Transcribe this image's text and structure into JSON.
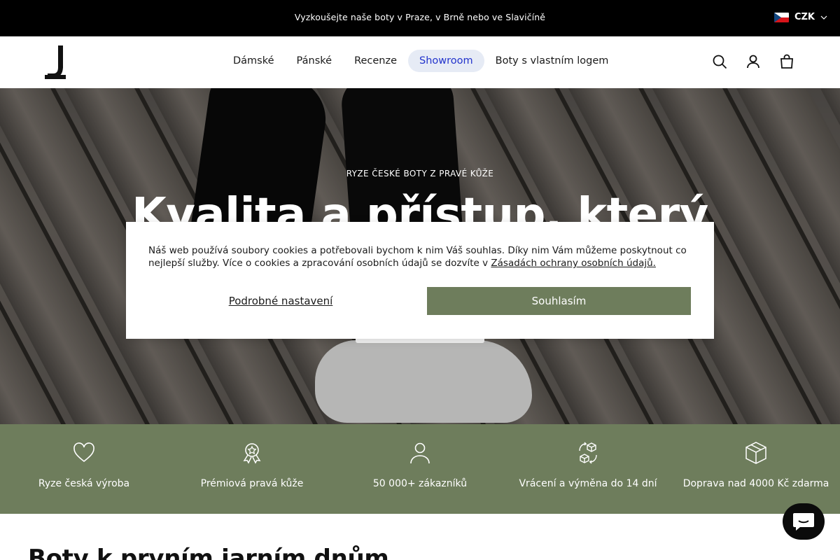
{
  "announcement": {
    "text": "Vyzkoušejte naše boty v Praze, v Brně nebo ve Slavičíně"
  },
  "currency": {
    "code": "CZK",
    "flag_icon": "czech-flag-icon",
    "chevron_icon": "chevron-down-icon"
  },
  "header": {
    "logo_icon": "j-logo-icon",
    "nav": [
      {
        "label": "Dámské",
        "active": false
      },
      {
        "label": "Pánské",
        "active": false
      },
      {
        "label": "Recenze",
        "active": false
      },
      {
        "label": "Showroom",
        "active": true
      },
      {
        "label": "Boty s vlastním logem",
        "active": false
      }
    ],
    "icons": [
      "search-icon",
      "account-icon",
      "cart-icon"
    ]
  },
  "hero": {
    "eyebrow": "RYZE ČESKÉ BOTY Z PRAVÉ KŮŽE",
    "headline": "Kvalita a přístup, který"
  },
  "cookie": {
    "text": "Náš web používá soubory cookies a potřebovali bychom k nim Váš souhlas. Díky nim Vám můžeme poskytnout co nejlepší služby. Více o cookies a zpracování osobních údajů se dozvíte v",
    "link": "Zásadách ochrany osobních údajů.",
    "settings_label": "Podrobné nastavení",
    "accept_label": "Souhlasím"
  },
  "features": [
    {
      "icon": "heart-icon",
      "label": "Ryze česká výroba"
    },
    {
      "icon": "award-badge-icon",
      "label": "Prémiová pravá kůže"
    },
    {
      "icon": "person-icon",
      "label": "50 000+ zákazníků"
    },
    {
      "icon": "exchange-boxes-icon",
      "label": "Vrácení a výměna do 14 dní"
    },
    {
      "icon": "package-icon",
      "label": "Doprava nad 4000 Kč zdarma"
    }
  ],
  "section": {
    "title": "Boty k prvním jarním dnům"
  },
  "chat": {
    "icon": "chat-icon"
  },
  "colors": {
    "accent_green": "#6e7d5c",
    "nav_active_bg": "#e6ebf5",
    "nav_active_text": "#2233cc",
    "topbar": "#000000"
  }
}
